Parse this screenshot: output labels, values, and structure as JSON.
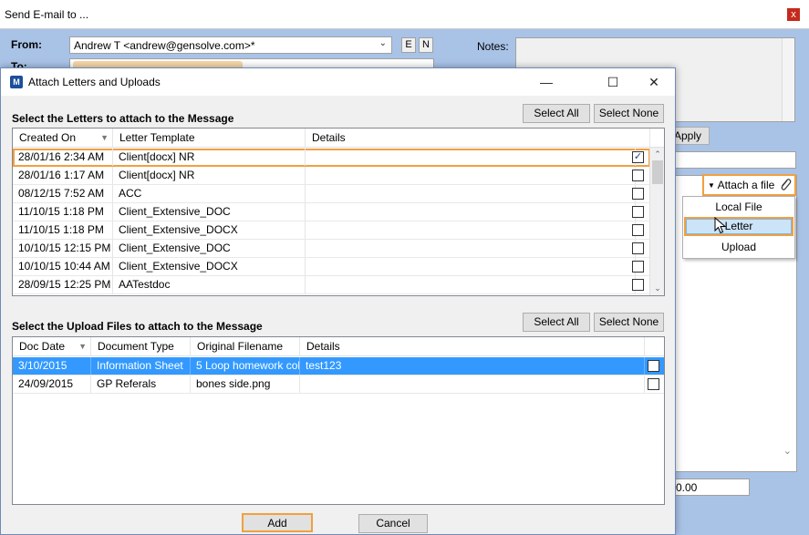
{
  "outer": {
    "title": "Send E-mail to ...",
    "close_glyph": "x",
    "from_label": "From:",
    "from_value": "Andrew T <andrew@gensolve.com>*",
    "to_label": "To:",
    "btn_e": "E",
    "btn_n": "N",
    "notes_label": "Notes:",
    "apply_label": "Apply",
    "attach_file_label": "Attach a file",
    "attach_menu": [
      "Local File",
      "Letter",
      "Upload"
    ],
    "amount_value": "0.00"
  },
  "dialog": {
    "title": "Attach Letters and Uploads",
    "letters_section_label": "Select the Letters to attach to the Message",
    "uploads_section_label": "Select the Upload Files to attach to the Message",
    "select_all_label": "Select All",
    "select_none_label": "Select None",
    "add_label": "Add",
    "cancel_label": "Cancel",
    "letters": {
      "columns": [
        "Created On",
        "Letter Template",
        "Details"
      ],
      "rows": [
        {
          "created": "28/01/16 2:34 AM",
          "template": "Client[docx] NR",
          "details": "",
          "checked": true
        },
        {
          "created": "28/01/16 1:17 AM",
          "template": "Client[docx] NR",
          "details": "",
          "checked": false
        },
        {
          "created": "08/12/15 7:52 AM",
          "template": "ACC",
          "details": "",
          "checked": false
        },
        {
          "created": "11/10/15 1:18 PM",
          "template": "Client_Extensive_DOC",
          "details": "",
          "checked": false
        },
        {
          "created": "11/10/15 1:18 PM",
          "template": "Client_Extensive_DOCX",
          "details": "",
          "checked": false
        },
        {
          "created": "10/10/15 12:15 PM",
          "template": "Client_Extensive_DOC",
          "details": "",
          "checked": false
        },
        {
          "created": "10/10/15 10:44 AM",
          "template": "Client_Extensive_DOCX",
          "details": "",
          "checked": false
        },
        {
          "created": "28/09/15 12:25 PM",
          "template": "AATestdoc",
          "details": "",
          "checked": false
        }
      ]
    },
    "uploads": {
      "columns": [
        "Doc Date",
        "Document Type",
        "Original Filename",
        "Details"
      ],
      "rows": [
        {
          "date": "3/10/2015",
          "type": "Information Sheet",
          "filename": "5 Loop homework col...",
          "details": "test123",
          "checked": false
        },
        {
          "date": "24/09/2015",
          "type": "GP Referals",
          "filename": "bones side.png",
          "details": "",
          "checked": false
        }
      ]
    }
  },
  "colors": {
    "window_bg": "#a9c3e7",
    "highlight_orange": "#f0a040",
    "selection_blue": "#3399ff",
    "dialog_bg": "#f0f0f0"
  },
  "icons": {
    "app": "app-logo-icon",
    "attach": "paperclip-icon",
    "dropdown": "chevron-down-icon",
    "check": "checkmark-icon"
  }
}
